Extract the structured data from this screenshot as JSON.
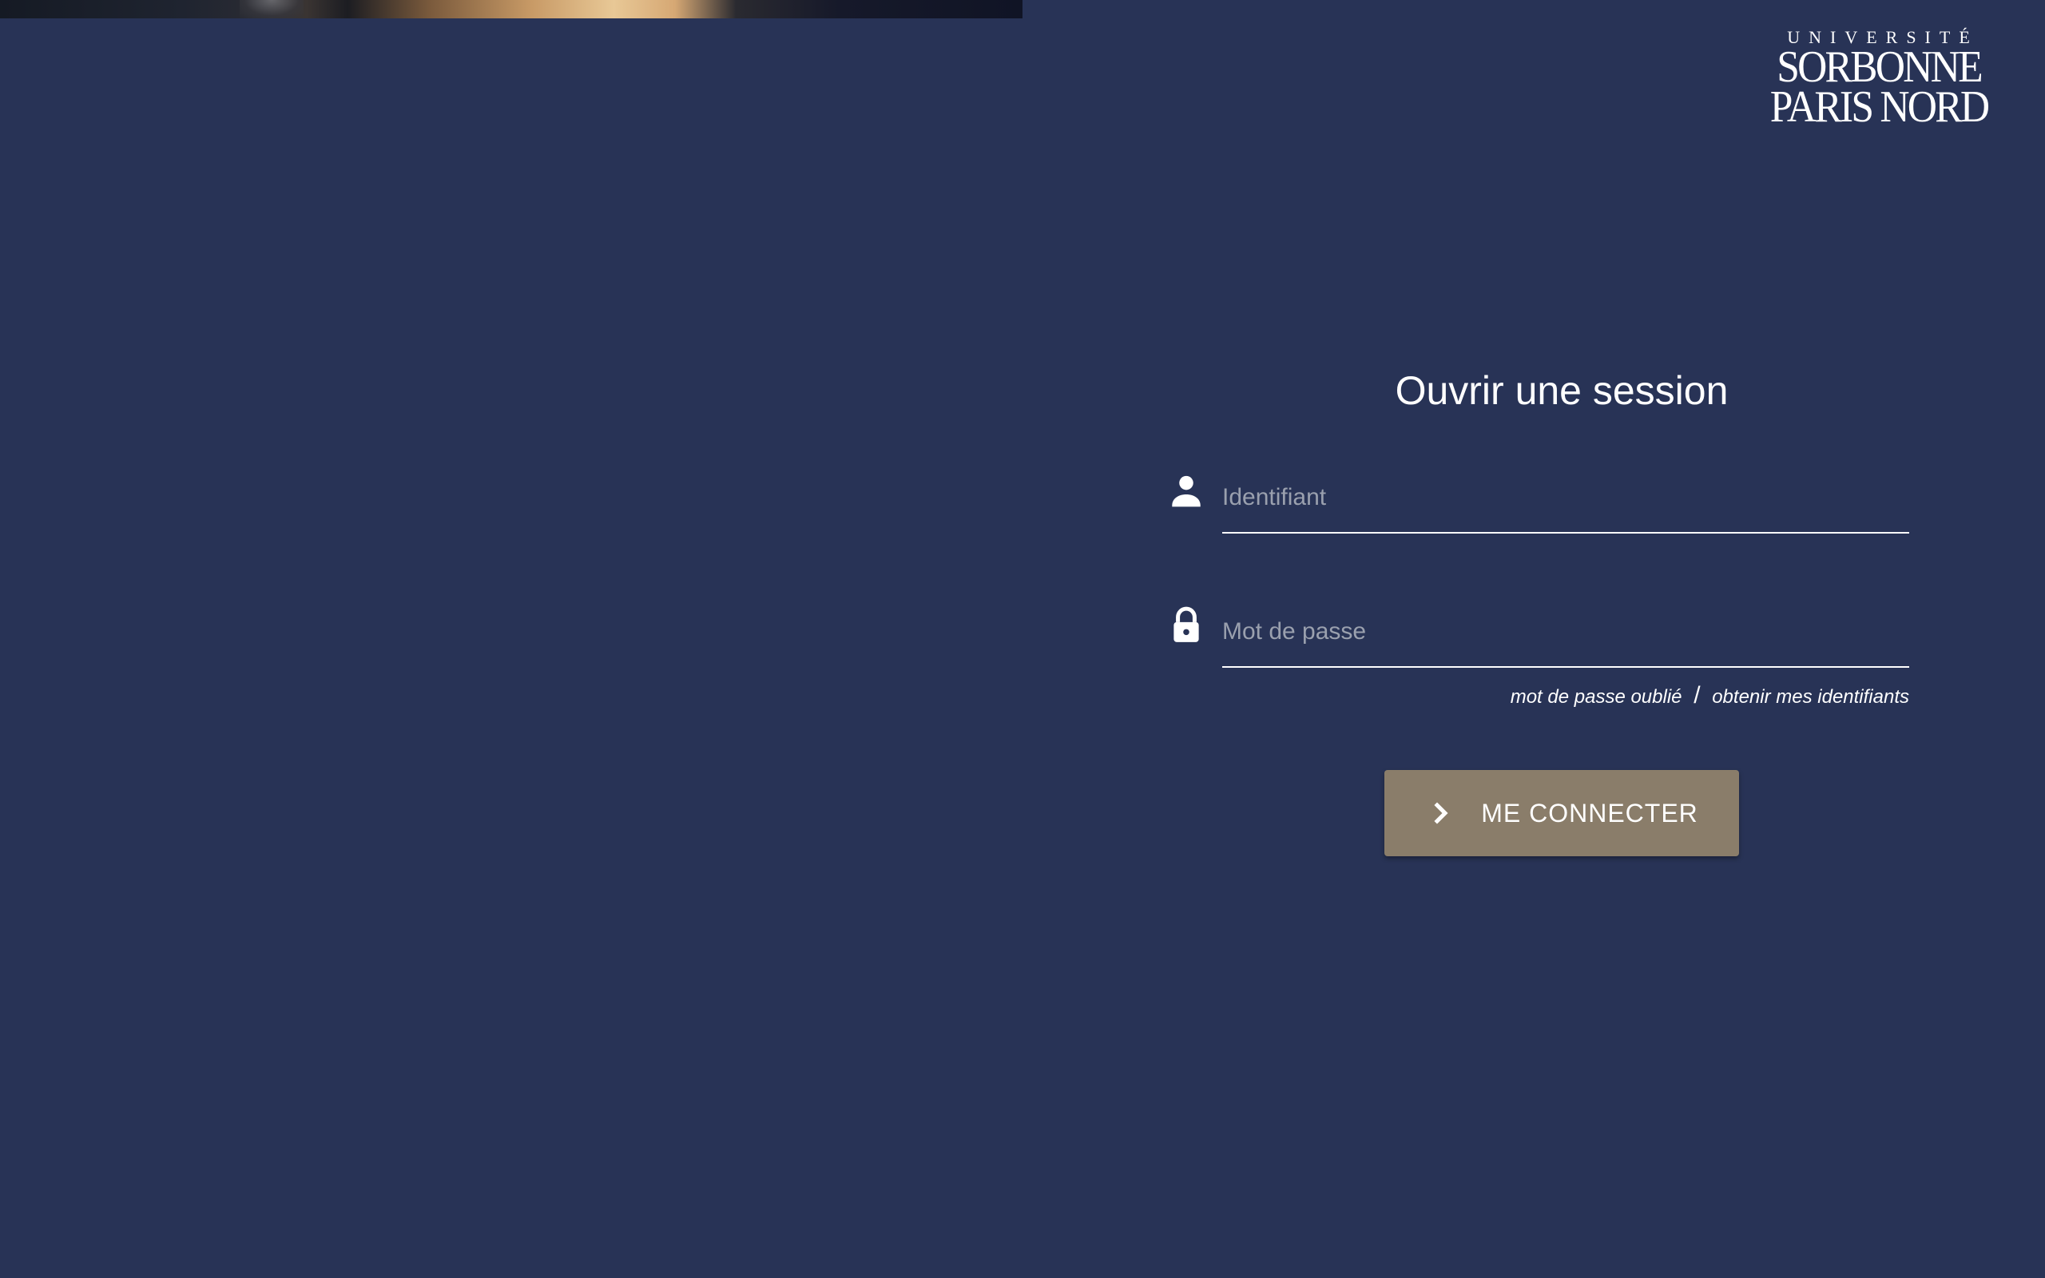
{
  "logo": {
    "top_line": "UNIVERSITÉ",
    "line1": "SORBONNE",
    "line2": "PARIS NORD"
  },
  "login": {
    "title": "Ouvrir une session",
    "username": {
      "placeholder": "Identifiant",
      "value": "",
      "icon": "person-icon"
    },
    "password": {
      "placeholder": "Mot de passe",
      "value": "",
      "icon": "lock-icon"
    },
    "links": {
      "forgot_password": "mot de passe oublié",
      "separator": "/",
      "get_credentials": "obtenir mes identifiants"
    },
    "submit_label": "ME CONNECTER",
    "submit_icon": "chevron-right-icon"
  },
  "colors": {
    "background": "#283356",
    "button": "#8a7d6a",
    "text": "#ffffff"
  }
}
